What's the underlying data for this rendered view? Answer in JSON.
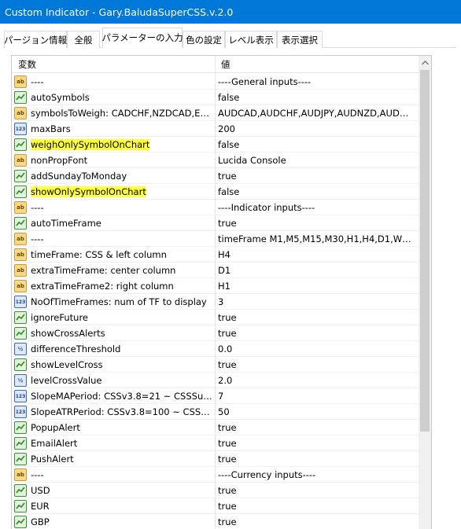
{
  "window": {
    "title": "Custom Indicator - Gary.BaludaSuperCSS.v.2.0"
  },
  "tabs": [
    {
      "label": "パージョン情報"
    },
    {
      "label": "全般"
    },
    {
      "label": "パラメーターの入力"
    },
    {
      "label": "色の設定"
    },
    {
      "label": "レベル表示"
    },
    {
      "label": "表示選択"
    }
  ],
  "table": {
    "headers": {
      "variable": "変数",
      "value": "値"
    },
    "rows": [
      {
        "icon": "ab",
        "name": "----",
        "value": "----General inputs----"
      },
      {
        "icon": "bool",
        "name": "autoSymbols",
        "value": "false"
      },
      {
        "icon": "ab",
        "name": "symbolsToWeigh: CADCHF,NZDCAD,EURC...",
        "value": "AUDCAD,AUDCHF,AUDJPY,AUDNZD,AUDUSD..."
      },
      {
        "icon": "int",
        "name": "maxBars",
        "value": "200"
      },
      {
        "icon": "bool",
        "name": "weighOnlySymbolOnChart",
        "value": "false",
        "highlight": true
      },
      {
        "icon": "ab",
        "name": "nonPropFont",
        "value": "Lucida Console"
      },
      {
        "icon": "bool",
        "name": "addSundayToMonday",
        "value": "true"
      },
      {
        "icon": "bool",
        "name": "showOnlySymbolOnChart",
        "value": "false",
        "highlight": true
      },
      {
        "icon": "ab",
        "name": "----",
        "value": "----Indicator inputs----"
      },
      {
        "icon": "bool",
        "name": "autoTimeFrame",
        "value": "true"
      },
      {
        "icon": "ab",
        "name": "----",
        "value": "timeFrame M1,M5,M15,M30,H1,H4,D1,W1,MN"
      },
      {
        "icon": "ab",
        "name": "timeFrame: CSS & left column",
        "value": "H4"
      },
      {
        "icon": "ab",
        "name": "extraTimeFrame: center column",
        "value": "D1"
      },
      {
        "icon": "ab",
        "name": "extraTimeFrame2: right column",
        "value": "H1"
      },
      {
        "icon": "int",
        "name": "NoOfTimeFrames: num of TF to display",
        "value": "3"
      },
      {
        "icon": "bool",
        "name": "ignoreFuture",
        "value": "true"
      },
      {
        "icon": "bool",
        "name": "showCrossAlerts",
        "value": "true"
      },
      {
        "icon": "dbl",
        "name": "differenceThreshold",
        "value": "0.0"
      },
      {
        "icon": "bool",
        "name": "showLevelCross",
        "value": "true"
      },
      {
        "icon": "dbl",
        "name": "levelCrossValue",
        "value": "2.0"
      },
      {
        "icon": "int",
        "name": "SlopeMAPeriod: CSSv3.8=21 ~ CSSSuper=7",
        "value": "7"
      },
      {
        "icon": "int",
        "name": "SlopeATRPeriod: CSSv3.8=100 ~ CSSSuper...",
        "value": "50"
      },
      {
        "icon": "bool",
        "name": "PopupAlert",
        "value": "true"
      },
      {
        "icon": "bool",
        "name": "EmailAlert",
        "value": "true"
      },
      {
        "icon": "bool",
        "name": "PushAlert",
        "value": "true"
      },
      {
        "icon": "ab",
        "name": "----",
        "value": "----Currency inputs----"
      },
      {
        "icon": "bool",
        "name": "USD",
        "value": "true"
      },
      {
        "icon": "bool",
        "name": "EUR",
        "value": "true"
      },
      {
        "icon": "bool",
        "name": "GBP",
        "value": "true"
      }
    ]
  },
  "icons": {
    "ab": "string-type-icon",
    "bool": "bool-type-icon",
    "int": "integer-type-icon",
    "dbl": "double-type-icon"
  },
  "colors": {
    "titlebar": "#0078d7",
    "highlight": "#ffff3a"
  }
}
